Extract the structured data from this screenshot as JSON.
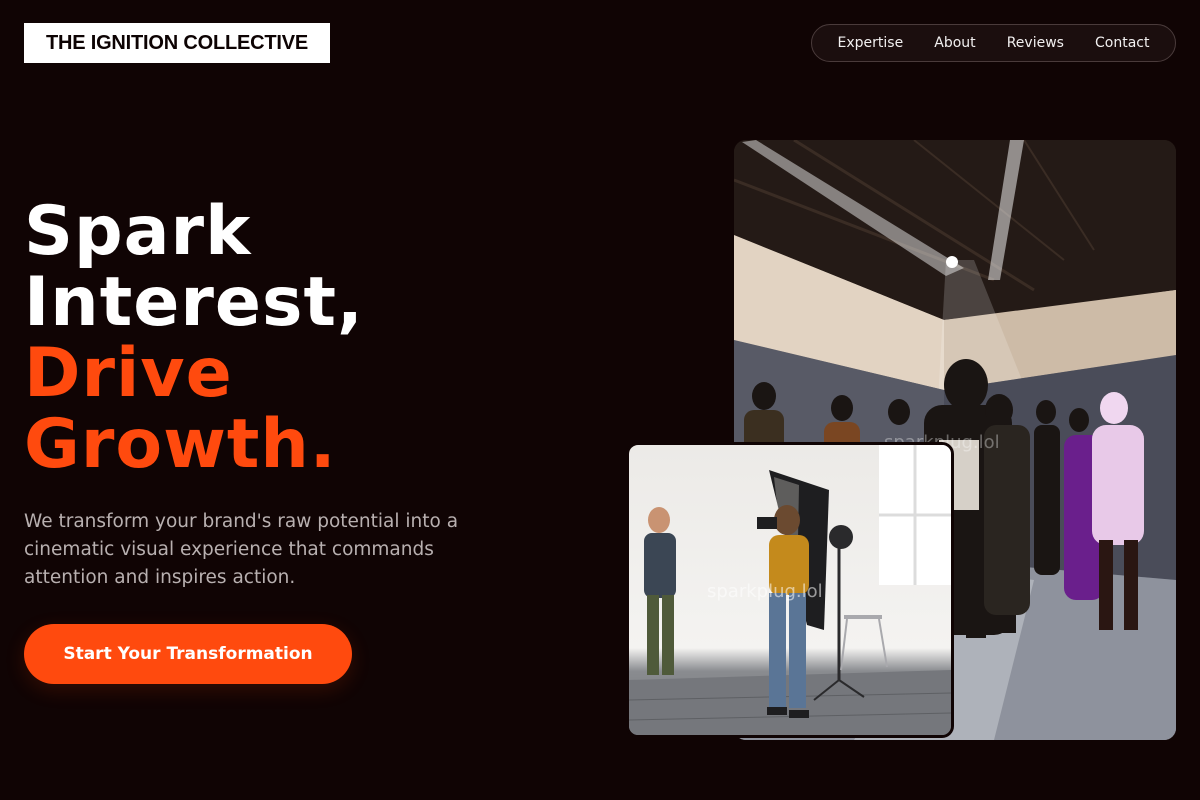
{
  "brand": {
    "name": "THE IGNITION COLLECTIVE"
  },
  "nav": {
    "items": [
      {
        "label": "Expertise"
      },
      {
        "label": "About"
      },
      {
        "label": "Reviews"
      },
      {
        "label": "Contact"
      }
    ]
  },
  "hero": {
    "line1": "Spark",
    "line2": "Interest,",
    "line3": "Drive",
    "line4": "Growth.",
    "subtitle": "We transform your brand's raw potential into a cinematic visual experience that commands attention and inspires action.",
    "cta_label": "Start Your Transformation"
  },
  "images": {
    "large_watermark": "sparkplug.lol",
    "small_watermark": "sparkplug.lol"
  },
  "colors": {
    "background": "#100404",
    "accent": "#ff4a0e",
    "text": "#ffffff",
    "muted": "#b8b0b0"
  }
}
